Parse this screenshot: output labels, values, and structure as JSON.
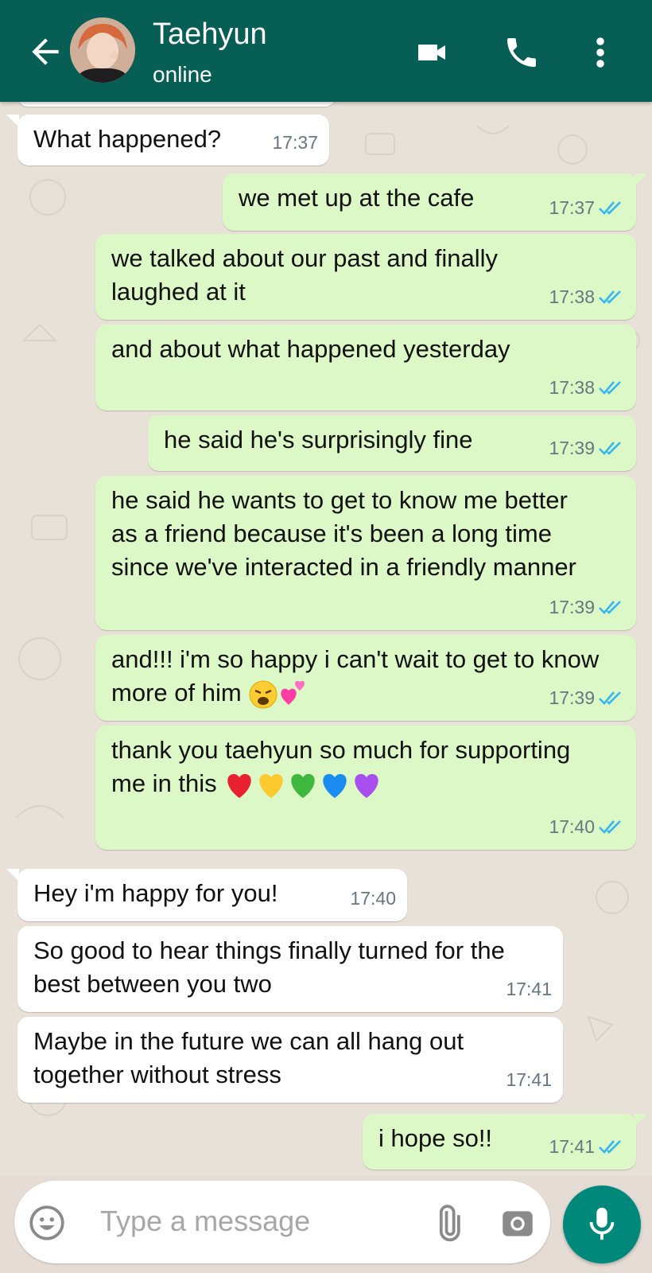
{
  "header": {
    "contact_name": "Taehyun",
    "status": "online",
    "icons": [
      "back-arrow-icon",
      "video-call-icon",
      "phone-icon",
      "more-vertical-icon"
    ]
  },
  "messages": [
    {
      "dir": "in",
      "text": "What happened?",
      "time": "17:37"
    },
    {
      "dir": "out",
      "text": "we met up at the cafe",
      "time": "17:37",
      "status": "read"
    },
    {
      "dir": "out",
      "text": "we talked about our past and finally laughed at it",
      "time": "17:38",
      "status": "read"
    },
    {
      "dir": "out",
      "text": "and about what happened yesterday",
      "time": "17:38",
      "status": "read"
    },
    {
      "dir": "out",
      "text": "he said he's surprisingly fine",
      "time": "17:39",
      "status": "read"
    },
    {
      "dir": "out",
      "text": "he said he wants to get to know me better as a friend because it's been a long time since we've interacted in a friendly manner",
      "time": "17:39",
      "status": "read"
    },
    {
      "dir": "out",
      "text": "and!!! i'm so happy i can't wait to get to know more of him",
      "emoji": [
        "weary-face-emoji",
        "two-hearts-emoji"
      ],
      "time": "17:39",
      "status": "read"
    },
    {
      "dir": "out",
      "text": "thank you taehyun so much for supporting me in this",
      "emoji": [
        "red-heart-emoji",
        "yellow-heart-emoji",
        "green-heart-emoji",
        "blue-heart-emoji",
        "purple-heart-emoji"
      ],
      "time": "17:40",
      "status": "read"
    },
    {
      "dir": "in",
      "text": "Hey i'm happy for you!",
      "time": "17:40"
    },
    {
      "dir": "in",
      "text": "So good to hear things finally turned for the best between you two",
      "time": "17:41"
    },
    {
      "dir": "in",
      "text": "Maybe in the future we can all hang out together without stress",
      "time": "17:41"
    },
    {
      "dir": "out",
      "text": "i hope so!!",
      "time": "17:41",
      "status": "read"
    }
  ],
  "composer": {
    "placeholder": "Type a message",
    "icons": [
      "emoji-icon",
      "attach-icon",
      "camera-icon",
      "mic-icon"
    ]
  },
  "colors": {
    "header": "#075e54",
    "outgoing_bubble": "#dcf8c6",
    "incoming_bubble": "#ffffff",
    "read_tick": "#34b7f1",
    "mic_button": "#00897b"
  }
}
